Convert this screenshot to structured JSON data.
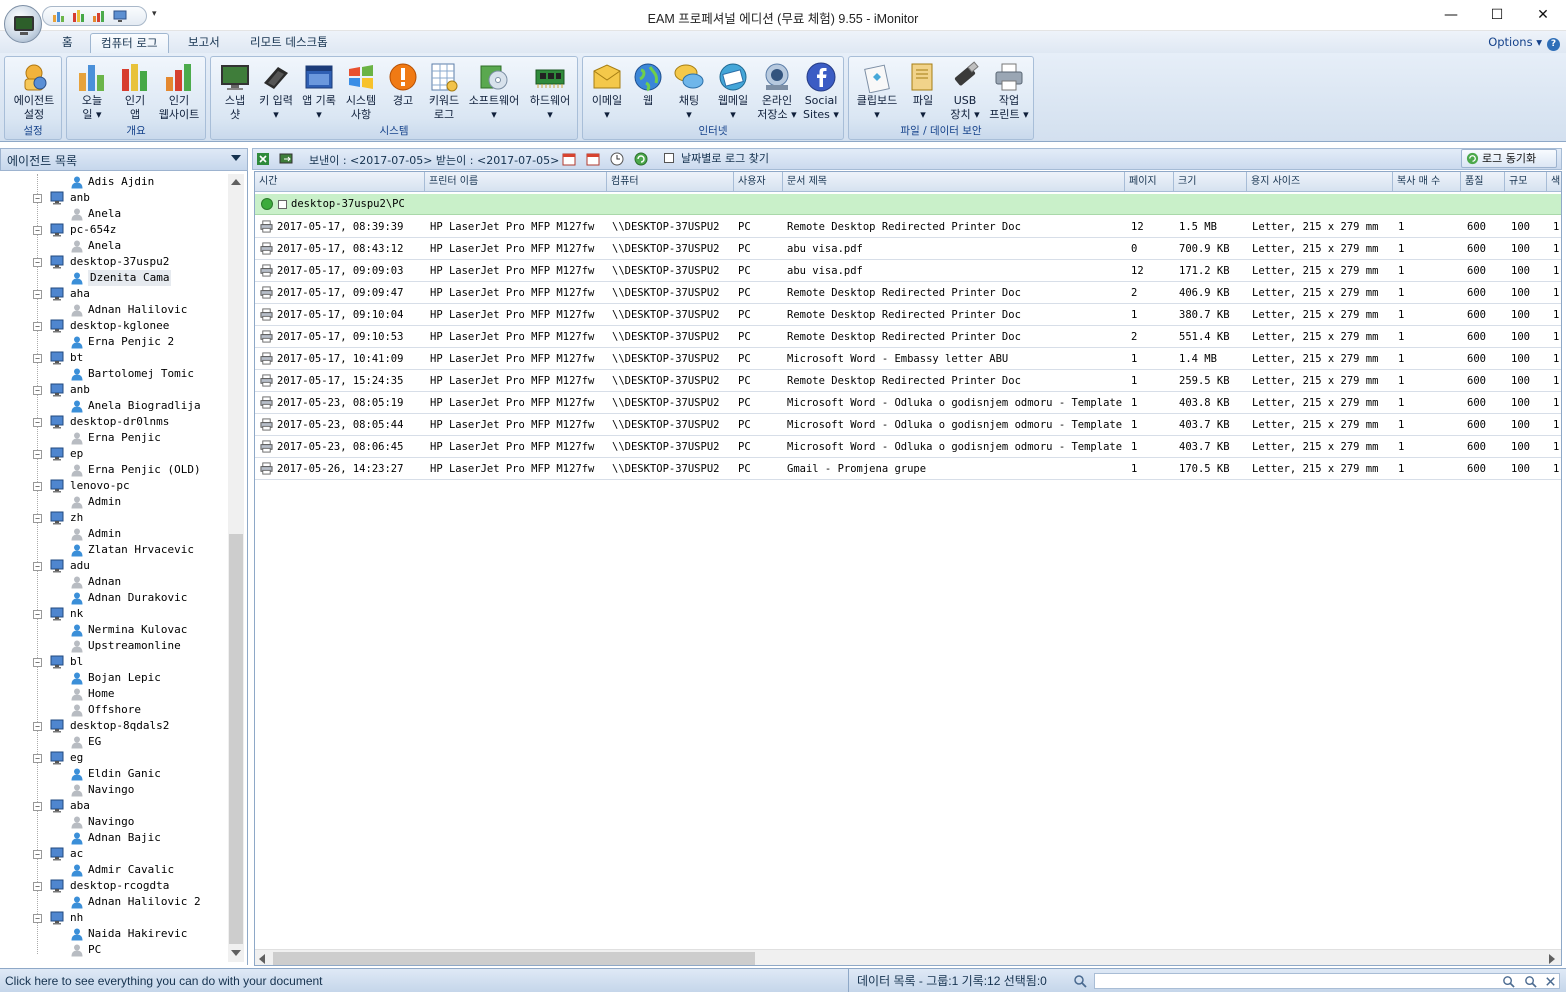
{
  "window": {
    "title": "EAM 프로페셔널 에디션 (무료 체험) 9.55 - iMonitor",
    "minimize": "—",
    "maximize": "☐",
    "close": "✕",
    "qat_more": "▾"
  },
  "ribbon": {
    "tabs": [
      "홈",
      "컴퓨터 로그",
      "보고서",
      "리모트 데스크톱"
    ],
    "active_tab": 1,
    "options_label": "Options",
    "groups": [
      {
        "label": "설정",
        "buttons": [
          {
            "l1": "에이전트",
            "l2": "설정",
            "icon": "agent-settings"
          }
        ]
      },
      {
        "label": "개요",
        "buttons": [
          {
            "l1": "오늘",
            "l2": "일",
            "icon": "today-chart"
          },
          {
            "l1": "인기",
            "l2": "앱",
            "icon": "popular-apps"
          },
          {
            "l1": "인기",
            "l2": "웹사이트",
            "icon": "popular-websites"
          }
        ]
      },
      {
        "label": "시스템",
        "buttons": [
          {
            "l1": "스냅",
            "l2": "샷",
            "icon": "snapshot"
          },
          {
            "l1": "키 입력",
            "l2": "",
            "icon": "keystrokes"
          },
          {
            "l1": "앱 기록",
            "l2": "",
            "icon": "app-record"
          },
          {
            "l1": "시스템",
            "l2": "사항",
            "icon": "system-events"
          },
          {
            "l1": "경고",
            "l2": "",
            "icon": "alert"
          },
          {
            "l1": "키워드",
            "l2": "로그",
            "icon": "keyword-log"
          },
          {
            "l1": "소프트웨어",
            "l2": "",
            "icon": "software"
          },
          {
            "l1": "하드웨어",
            "l2": "",
            "icon": "hardware"
          }
        ]
      },
      {
        "label": "인터넷",
        "buttons": [
          {
            "l1": "이메일",
            "l2": "",
            "icon": "email"
          },
          {
            "l1": "웹",
            "l2": "",
            "icon": "web"
          },
          {
            "l1": "채팅",
            "l2": "",
            "icon": "chat"
          },
          {
            "l1": "웹메일",
            "l2": "",
            "icon": "webmail"
          },
          {
            "l1": "온라인",
            "l2": "저장소",
            "icon": "online-storage"
          },
          {
            "l1": "Social",
            "l2": "Sites",
            "icon": "social-sites"
          }
        ]
      },
      {
        "label": "파일 / 데이터 보안",
        "buttons": [
          {
            "l1": "클립보드",
            "l2": "",
            "icon": "clipboard"
          },
          {
            "l1": "파일",
            "l2": "",
            "icon": "file"
          },
          {
            "l1": "USB",
            "l2": "장치",
            "icon": "usb"
          },
          {
            "l1": "작업",
            "l2": "프린트",
            "icon": "print-job"
          }
        ]
      }
    ]
  },
  "agent_panel": {
    "title": "에이전트 목록",
    "tree": [
      {
        "type": "user",
        "label": "Adis Ajdin",
        "active": true
      },
      {
        "type": "pc",
        "label": "anb"
      },
      {
        "type": "user",
        "label": "Anela",
        "active": false
      },
      {
        "type": "pc",
        "label": "pc-654z"
      },
      {
        "type": "user",
        "label": "Anela",
        "active": false
      },
      {
        "type": "pc",
        "label": "desktop-37uspu2"
      },
      {
        "type": "user",
        "label": "Dzenita Cama",
        "active": true,
        "selected": true
      },
      {
        "type": "pc",
        "label": "aha"
      },
      {
        "type": "user",
        "label": "Adnan Halilovic",
        "active": false
      },
      {
        "type": "pc",
        "label": "desktop-kglonee"
      },
      {
        "type": "user",
        "label": "Erna Penjic 2",
        "active": true
      },
      {
        "type": "pc",
        "label": "bt"
      },
      {
        "type": "user",
        "label": "Bartolomej Tomic",
        "active": true
      },
      {
        "type": "pc",
        "label": "anb"
      },
      {
        "type": "user",
        "label": "Anela Biogradlija",
        "active": true
      },
      {
        "type": "pc",
        "label": "desktop-dr0lnms"
      },
      {
        "type": "user",
        "label": "Erna Penjic",
        "active": false
      },
      {
        "type": "pc",
        "label": "ep"
      },
      {
        "type": "user",
        "label": "Erna Penjic (OLD)",
        "active": false
      },
      {
        "type": "pc",
        "label": "lenovo-pc"
      },
      {
        "type": "user",
        "label": "Admin",
        "active": false
      },
      {
        "type": "pc",
        "label": "zh"
      },
      {
        "type": "user",
        "label": "Admin",
        "active": false
      },
      {
        "type": "user",
        "label": "Zlatan Hrvacevic",
        "active": true
      },
      {
        "type": "pc",
        "label": "adu"
      },
      {
        "type": "user",
        "label": "Adnan",
        "active": false
      },
      {
        "type": "user",
        "label": "Adnan Durakovic",
        "active": true
      },
      {
        "type": "pc",
        "label": "nk"
      },
      {
        "type": "user",
        "label": "Nermina Kulovac",
        "active": true
      },
      {
        "type": "user",
        "label": "Upstreamonline",
        "active": false
      },
      {
        "type": "pc",
        "label": "bl"
      },
      {
        "type": "user",
        "label": "Bojan Lepic",
        "active": true
      },
      {
        "type": "user",
        "label": "Home",
        "active": false
      },
      {
        "type": "user",
        "label": "Offshore",
        "active": false
      },
      {
        "type": "pc",
        "label": "desktop-8qdals2"
      },
      {
        "type": "user",
        "label": "EG",
        "active": false
      },
      {
        "type": "pc",
        "label": "eg"
      },
      {
        "type": "user",
        "label": "Eldin Ganic",
        "active": true
      },
      {
        "type": "user",
        "label": "Navingo",
        "active": false
      },
      {
        "type": "pc",
        "label": "aba"
      },
      {
        "type": "user",
        "label": "Navingo",
        "active": false
      },
      {
        "type": "user",
        "label": "Adnan Bajic",
        "active": true
      },
      {
        "type": "pc",
        "label": "ac"
      },
      {
        "type": "user",
        "label": "Admir Cavalic",
        "active": true
      },
      {
        "type": "pc",
        "label": "desktop-rcogdta"
      },
      {
        "type": "user",
        "label": "Adnan Halilovic 2",
        "active": true
      },
      {
        "type": "pc",
        "label": "nh"
      },
      {
        "type": "user",
        "label": "Naida Hakirevic",
        "active": true
      },
      {
        "type": "user",
        "label": "PC",
        "active": false
      }
    ]
  },
  "toolbar": {
    "date_range": "보낸이 : <2017-07-05> 받는이 : <2017-07-05>",
    "find_by_date": "날짜별로 로그 찾기",
    "sync_label": "로그 동기화"
  },
  "grid": {
    "columns": [
      "시간",
      "프린터 이름",
      "컴퓨터",
      "사용자",
      "문서 제목",
      "페이지",
      "크기",
      "용지 사이즈",
      "복사 매 수",
      "품질",
      "규모",
      "색"
    ],
    "group_label": "desktop-37uspu2\\PC",
    "rows": [
      [
        "2017-05-17, 08:39:39",
        "HP LaserJet Pro MFP M127fw",
        "\\\\DESKTOP-37USPU2",
        "PC",
        "Remote Desktop Redirected Printer Doc",
        "12",
        "1.5 MB",
        "Letter, 215 x 279 mm",
        "1",
        "600",
        "100",
        "1"
      ],
      [
        "2017-05-17, 08:43:12",
        "HP LaserJet Pro MFP M127fw",
        "\\\\DESKTOP-37USPU2",
        "PC",
        "abu visa.pdf",
        "0",
        "700.9 KB",
        "Letter, 215 x 279 mm",
        "1",
        "600",
        "100",
        "1"
      ],
      [
        "2017-05-17, 09:09:03",
        "HP LaserJet Pro MFP M127fw",
        "\\\\DESKTOP-37USPU2",
        "PC",
        "abu visa.pdf",
        "12",
        "171.2 KB",
        "Letter, 215 x 279 mm",
        "1",
        "600",
        "100",
        "1"
      ],
      [
        "2017-05-17, 09:09:47",
        "HP LaserJet Pro MFP M127fw",
        "\\\\DESKTOP-37USPU2",
        "PC",
        "Remote Desktop Redirected Printer Doc",
        "2",
        "406.9 KB",
        "Letter, 215 x 279 mm",
        "1",
        "600",
        "100",
        "1"
      ],
      [
        "2017-05-17, 09:10:04",
        "HP LaserJet Pro MFP M127fw",
        "\\\\DESKTOP-37USPU2",
        "PC",
        "Remote Desktop Redirected Printer Doc",
        "1",
        "380.7 KB",
        "Letter, 215 x 279 mm",
        "1",
        "600",
        "100",
        "1"
      ],
      [
        "2017-05-17, 09:10:53",
        "HP LaserJet Pro MFP M127fw",
        "\\\\DESKTOP-37USPU2",
        "PC",
        "Remote Desktop Redirected Printer Doc",
        "2",
        "551.4 KB",
        "Letter, 215 x 279 mm",
        "1",
        "600",
        "100",
        "1"
      ],
      [
        "2017-05-17, 10:41:09",
        "HP LaserJet Pro MFP M127fw",
        "\\\\DESKTOP-37USPU2",
        "PC",
        "Microsoft Word - Embassy letter ABU",
        "1",
        "1.4 MB",
        "Letter, 215 x 279 mm",
        "1",
        "600",
        "100",
        "1"
      ],
      [
        "2017-05-17, 15:24:35",
        "HP LaserJet Pro MFP M127fw",
        "\\\\DESKTOP-37USPU2",
        "PC",
        "Remote Desktop Redirected Printer Doc",
        "1",
        "259.5 KB",
        "Letter, 215 x 279 mm",
        "1",
        "600",
        "100",
        "1"
      ],
      [
        "2017-05-23, 08:05:19",
        "HP LaserJet Pro MFP M127fw",
        "\\\\DESKTOP-37USPU2",
        "PC",
        "Microsoft Word - Odluka o godisnjem odmoru - Template",
        "1",
        "403.8 KB",
        "Letter, 215 x 279 mm",
        "1",
        "600",
        "100",
        "1"
      ],
      [
        "2017-05-23, 08:05:44",
        "HP LaserJet Pro MFP M127fw",
        "\\\\DESKTOP-37USPU2",
        "PC",
        "Microsoft Word - Odluka o godisnjem odmoru - Template",
        "1",
        "403.7 KB",
        "Letter, 215 x 279 mm",
        "1",
        "600",
        "100",
        "1"
      ],
      [
        "2017-05-23, 08:06:45",
        "HP LaserJet Pro MFP M127fw",
        "\\\\DESKTOP-37USPU2",
        "PC",
        "Microsoft Word - Odluka o godisnjem odmoru - Template",
        "1",
        "403.7 KB",
        "Letter, 215 x 279 mm",
        "1",
        "600",
        "100",
        "1"
      ],
      [
        "2017-05-26, 14:23:27",
        "HP LaserJet Pro MFP M127fw",
        "\\\\DESKTOP-37USPU2",
        "PC",
        "Gmail - Promjena grupe",
        "1",
        "170.5 KB",
        "Letter, 215 x 279 mm",
        "1",
        "600",
        "100",
        "1"
      ]
    ]
  },
  "status": {
    "left": "Click here to see everything you can do with your document",
    "right": "데이터 목록 - 그룹:1  기록:12  선택됨:0"
  },
  "colors": {
    "ribbon_text": "#15428b",
    "group_row_bg": "#c9f0c9",
    "user_active": "#3b8fd8",
    "user_inactive": "#b8bcc2"
  }
}
